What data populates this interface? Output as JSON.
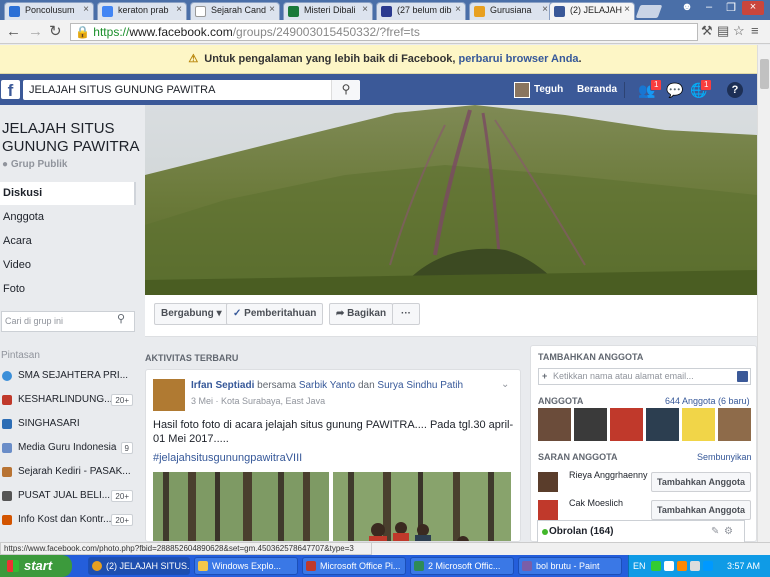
{
  "browser": {
    "tabs": [
      {
        "label": "Poncolusum",
        "color": "#2a6fd6"
      },
      {
        "label": "keraton prab",
        "color": "#4285f4"
      },
      {
        "label": "Sejarah Cand",
        "color": "#ffffff"
      },
      {
        "label": "Misteri Dibali",
        "color": "#1a7a3a"
      },
      {
        "label": "(27 belum dib",
        "color": "#2b3a8f"
      },
      {
        "label": "Gurusiana",
        "color": "#e8a020"
      },
      {
        "label": "(2) JELAJAH",
        "color": "#3b5998"
      }
    ],
    "url_scheme": "https://",
    "url_host": "www.facebook.com",
    "url_path": "/groups/249003015450332/?fref=ts"
  },
  "infobar": {
    "text": "Untuk pengalaman yang lebih baik di Facebook,",
    "link": "perbarui browser Anda",
    "end": "."
  },
  "fbheader": {
    "logo": "f",
    "search_value": "JELAJAH SITUS GUNUNG PAWITRA",
    "user": "Teguh",
    "home": "Beranda",
    "friend_badge": "1",
    "notif_badge": "1",
    "help": "?"
  },
  "group": {
    "title": "JELAJAH SITUS GUNUNG PAWITRA",
    "privacy": "Grup Publik",
    "nav": [
      "Diskusi",
      "Anggota",
      "Acara",
      "Video",
      "Foto"
    ],
    "search_placeholder": "Cari di grup ini",
    "shortcuts_title": "Pintasan",
    "shortcuts": [
      {
        "label": "SMA SEJAHTERA PRI...",
        "count": "",
        "color": "#3b8fd9"
      },
      {
        "label": "KESHARLINDUNG...",
        "count": "20+",
        "color": "#c0392b"
      },
      {
        "label": "SINGHASARI",
        "count": "",
        "color": "#2c6db5"
      },
      {
        "label": "Media Guru Indonesia",
        "count": "9",
        "color": "#6a8dc8"
      },
      {
        "label": "Sejarah Kediri - PASAK...",
        "count": "",
        "color": "#b87333"
      },
      {
        "label": "PUSAT JUAL BELI...",
        "count": "20+",
        "color": "#555555"
      },
      {
        "label": "Info Kost dan Kontr...",
        "count": "20+",
        "color": "#d35400"
      }
    ]
  },
  "cover_actions": {
    "join": "Bergabung",
    "notifications": "Pemberitahuan",
    "share": "Bagikan",
    "more": "···"
  },
  "feed": {
    "section": "AKTIVITAS TERBARU",
    "post": {
      "author": "Irfan Septiadi",
      "with_word": "bersama",
      "tag1": "Sarbik Yanto",
      "and_word": "dan",
      "tag2": "Surya Sindhu Patih",
      "meta": "3 Mei · Kota Surabaya, East Java",
      "text": "Hasil foto foto di acara jelajah situs gunung PAWITRA.... Pada tgl.30 april-01 Mei 2017.....",
      "hashtag": "#jelajahsitusgunungpawitraVIII"
    }
  },
  "right": {
    "add_member_title": "TAMBAHKAN ANGGOTA",
    "add_member_placeholder": "Ketikkan nama atau alamat email...",
    "members_title": "ANGGOTA",
    "members_count": "644 Anggota (6 baru)",
    "suggested_title": "SARAN ANGGOTA",
    "hide": "Sembunyikan",
    "suggestions": [
      {
        "name": "Rieya Anggrhaenny",
        "button": "Tambahkan Anggota"
      },
      {
        "name": "Cak Moeslich",
        "button": "Tambahkan Anggota"
      }
    ],
    "chat_label": "Obrolan (164)"
  },
  "status_url": "https://www.facebook.com/photo.php?fbid=288852604890628&set=gm.450362578647707&type=3",
  "taskbar": {
    "start": "start",
    "items": [
      {
        "label": "(2) JELAJAH SITUS...",
        "color": "#e8a020"
      },
      {
        "label": "Windows Explo...",
        "color": "#f3c74a"
      },
      {
        "label": "Microsoft Office Pi...",
        "color": "#c0392b"
      },
      {
        "label": "2 Microsoft Offic...",
        "color": "#2e8b57"
      },
      {
        "label": "bol brutu - Paint",
        "color": "#7a5ea8"
      }
    ],
    "lang": "EN",
    "clock": "3:57 AM"
  }
}
